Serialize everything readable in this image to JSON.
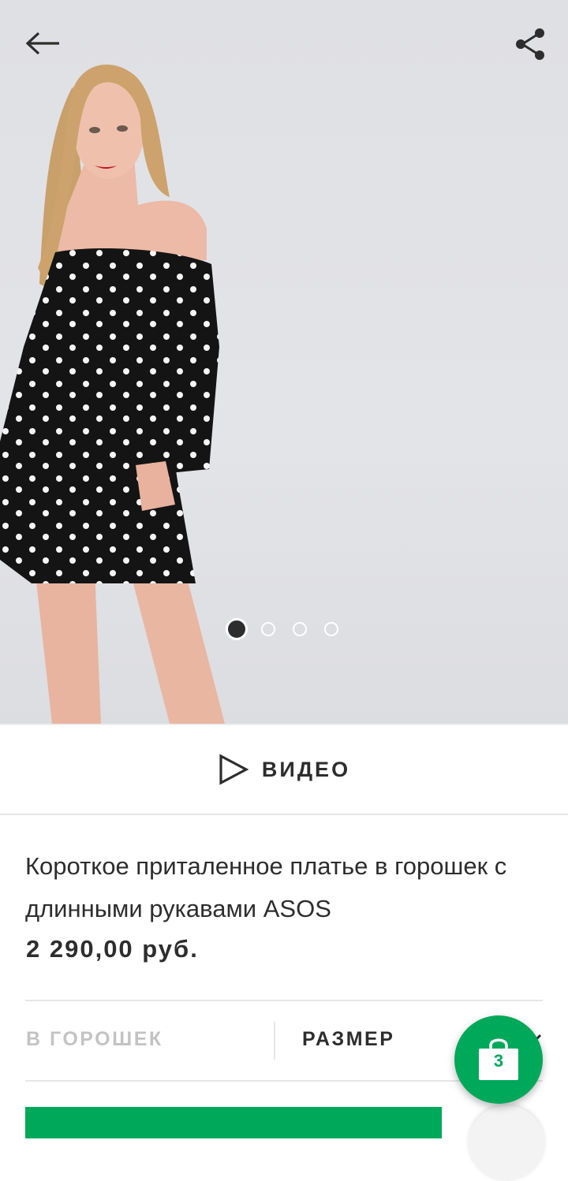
{
  "gallery": {
    "image_count": 4,
    "active_index": 0
  },
  "video": {
    "label": "ВИДЕО"
  },
  "product": {
    "title": "Короткое приталенное платье в горошек с длинными рукавами ASOS",
    "price": "2 290,00 руб."
  },
  "options": {
    "colour": "В ГОРОШЕК",
    "size": "РАЗМЕР"
  },
  "bag": {
    "count": "3"
  },
  "colors": {
    "accent": "#00a85a",
    "text": "#2d2d2d",
    "muted": "#c3c3c3"
  },
  "icons": [
    "arrow-left-icon",
    "share-icon",
    "play-icon",
    "chevron-down-icon",
    "shopping-bag-icon"
  ]
}
